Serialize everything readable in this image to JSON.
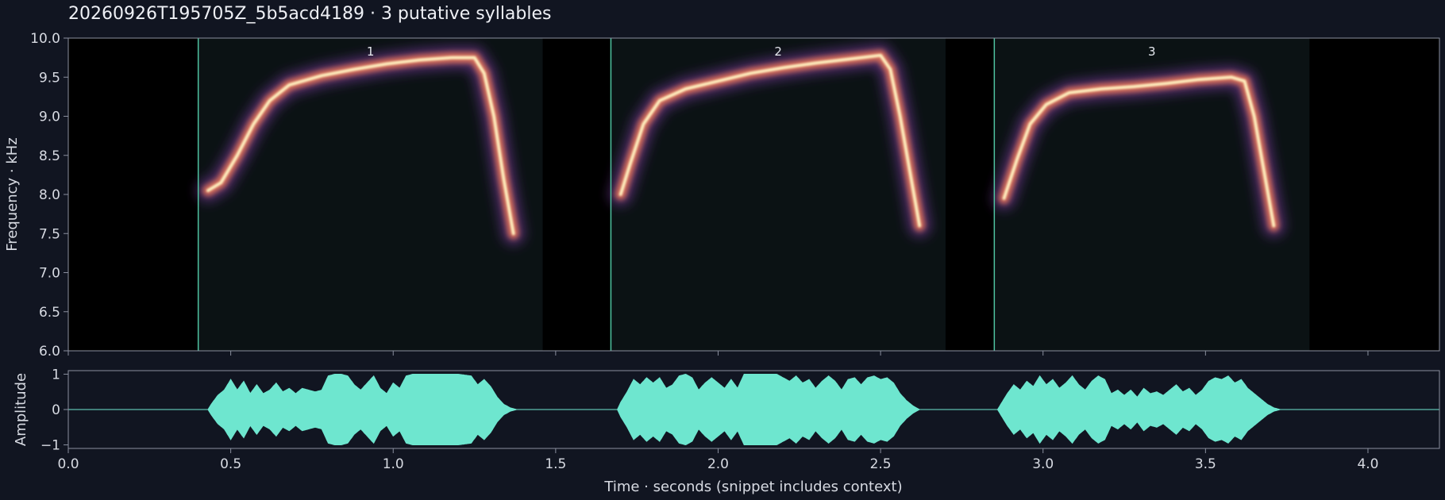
{
  "chart_data": [
    {
      "type": "heatmap",
      "title": "20260926T195705Z_5b5acd4189  ·  3 putative syllables",
      "ylabel": "Frequency · kHz",
      "xlim": [
        0.0,
        4.22
      ],
      "ylim": [
        6.0,
        10.0
      ],
      "yticks": [
        "6.0",
        "6.5",
        "7.0",
        "7.5",
        "8.0",
        "8.5",
        "9.0",
        "9.5",
        "10.0"
      ],
      "yticks_values": [
        6.0,
        6.5,
        7.0,
        7.5,
        8.0,
        8.5,
        9.0,
        9.5,
        10.0
      ],
      "xticks_values": [
        0.0,
        0.5,
        1.0,
        1.5,
        2.0,
        2.5,
        3.0,
        3.5,
        4.0
      ],
      "grid": false,
      "syllables": [
        {
          "label": "1",
          "start": 0.4,
          "end": 1.46,
          "contour": [
            [
              0.43,
              8.05
            ],
            [
              0.47,
              8.15
            ],
            [
              0.52,
              8.5
            ],
            [
              0.57,
              8.9
            ],
            [
              0.62,
              9.2
            ],
            [
              0.68,
              9.4
            ],
            [
              0.78,
              9.52
            ],
            [
              0.88,
              9.6
            ],
            [
              0.98,
              9.67
            ],
            [
              1.08,
              9.72
            ],
            [
              1.18,
              9.75
            ],
            [
              1.25,
              9.75
            ],
            [
              1.28,
              9.55
            ],
            [
              1.31,
              9.0
            ],
            [
              1.34,
              8.2
            ],
            [
              1.37,
              7.5
            ]
          ]
        },
        {
          "label": "2",
          "start": 1.67,
          "end": 2.7,
          "contour": [
            [
              1.7,
              8.0
            ],
            [
              1.73,
              8.4
            ],
            [
              1.77,
              8.9
            ],
            [
              1.82,
              9.2
            ],
            [
              1.9,
              9.35
            ],
            [
              2.0,
              9.45
            ],
            [
              2.1,
              9.55
            ],
            [
              2.2,
              9.62
            ],
            [
              2.3,
              9.68
            ],
            [
              2.4,
              9.73
            ],
            [
              2.5,
              9.78
            ],
            [
              2.53,
              9.6
            ],
            [
              2.56,
              9.0
            ],
            [
              2.59,
              8.3
            ],
            [
              2.62,
              7.6
            ]
          ]
        },
        {
          "label": "3",
          "start": 2.85,
          "end": 3.82,
          "contour": [
            [
              2.88,
              7.95
            ],
            [
              2.92,
              8.45
            ],
            [
              2.96,
              8.9
            ],
            [
              3.01,
              9.15
            ],
            [
              3.08,
              9.3
            ],
            [
              3.18,
              9.35
            ],
            [
              3.28,
              9.38
            ],
            [
              3.38,
              9.42
            ],
            [
              3.48,
              9.47
            ],
            [
              3.58,
              9.5
            ],
            [
              3.62,
              9.45
            ],
            [
              3.65,
              9.0
            ],
            [
              3.68,
              8.3
            ],
            [
              3.71,
              7.6
            ]
          ]
        }
      ]
    },
    {
      "type": "line",
      "ylabel": "Amplitude",
      "xlabel": "Time · seconds (snippet includes context)",
      "xlim": [
        0.0,
        4.22
      ],
      "ylim": [
        -1.1,
        1.1
      ],
      "yticks": [
        "−1",
        "0",
        "1"
      ],
      "yticks_values": [
        -1,
        0,
        1
      ],
      "xticks": [
        "0.0",
        "0.5",
        "1.0",
        "1.5",
        "2.0",
        "2.5",
        "3.0",
        "3.5",
        "4.0"
      ],
      "xticks_values": [
        0.0,
        0.5,
        1.0,
        1.5,
        2.0,
        2.5,
        3.0,
        3.5,
        4.0
      ],
      "series": [
        {
          "envelope": [
            [
              0.0,
              0.0
            ],
            [
              0.43,
              0.0
            ],
            [
              0.44,
              0.15
            ],
            [
              0.46,
              0.4
            ],
            [
              0.48,
              0.55
            ],
            [
              0.5,
              0.85
            ],
            [
              0.52,
              0.55
            ],
            [
              0.54,
              0.8
            ],
            [
              0.56,
              0.45
            ],
            [
              0.58,
              0.7
            ],
            [
              0.6,
              0.45
            ],
            [
              0.62,
              0.55
            ],
            [
              0.64,
              0.75
            ],
            [
              0.66,
              0.5
            ],
            [
              0.68,
              0.6
            ],
            [
              0.7,
              0.45
            ],
            [
              0.72,
              0.6
            ],
            [
              0.74,
              0.55
            ],
            [
              0.76,
              0.5
            ],
            [
              0.78,
              0.55
            ],
            [
              0.8,
              0.95
            ],
            [
              0.82,
              1.0
            ],
            [
              0.84,
              1.0
            ],
            [
              0.86,
              0.95
            ],
            [
              0.88,
              0.7
            ],
            [
              0.9,
              0.55
            ],
            [
              0.92,
              0.75
            ],
            [
              0.94,
              0.95
            ],
            [
              0.96,
              0.6
            ],
            [
              0.98,
              0.45
            ],
            [
              1.0,
              0.75
            ],
            [
              1.02,
              0.6
            ],
            [
              1.04,
              0.95
            ],
            [
              1.06,
              1.0
            ],
            [
              1.1,
              1.0
            ],
            [
              1.15,
              1.0
            ],
            [
              1.2,
              1.0
            ],
            [
              1.24,
              0.95
            ],
            [
              1.26,
              0.7
            ],
            [
              1.28,
              0.85
            ],
            [
              1.3,
              0.65
            ],
            [
              1.32,
              0.35
            ],
            [
              1.34,
              0.15
            ],
            [
              1.36,
              0.05
            ],
            [
              1.38,
              0.0
            ],
            [
              1.69,
              0.0
            ],
            [
              1.7,
              0.2
            ],
            [
              1.72,
              0.5
            ],
            [
              1.74,
              0.85
            ],
            [
              1.76,
              0.7
            ],
            [
              1.78,
              0.9
            ],
            [
              1.8,
              0.75
            ],
            [
              1.82,
              0.9
            ],
            [
              1.84,
              0.6
            ],
            [
              1.86,
              0.7
            ],
            [
              1.88,
              0.95
            ],
            [
              1.9,
              1.0
            ],
            [
              1.92,
              0.9
            ],
            [
              1.94,
              0.55
            ],
            [
              1.96,
              0.75
            ],
            [
              1.98,
              0.9
            ],
            [
              2.0,
              0.75
            ],
            [
              2.02,
              0.6
            ],
            [
              2.04,
              0.85
            ],
            [
              2.06,
              0.6
            ],
            [
              2.08,
              1.0
            ],
            [
              2.1,
              1.0
            ],
            [
              2.14,
              1.0
            ],
            [
              2.18,
              1.0
            ],
            [
              2.2,
              0.9
            ],
            [
              2.22,
              0.8
            ],
            [
              2.24,
              0.95
            ],
            [
              2.26,
              0.75
            ],
            [
              2.28,
              0.85
            ],
            [
              2.3,
              0.6
            ],
            [
              2.32,
              0.8
            ],
            [
              2.34,
              0.95
            ],
            [
              2.36,
              0.8
            ],
            [
              2.38,
              0.55
            ],
            [
              2.4,
              0.85
            ],
            [
              2.42,
              0.9
            ],
            [
              2.44,
              0.7
            ],
            [
              2.46,
              0.9
            ],
            [
              2.48,
              0.95
            ],
            [
              2.5,
              0.85
            ],
            [
              2.52,
              0.9
            ],
            [
              2.54,
              0.75
            ],
            [
              2.56,
              0.45
            ],
            [
              2.58,
              0.25
            ],
            [
              2.6,
              0.1
            ],
            [
              2.62,
              0.0
            ],
            [
              2.86,
              0.0
            ],
            [
              2.87,
              0.15
            ],
            [
              2.89,
              0.45
            ],
            [
              2.91,
              0.7
            ],
            [
              2.93,
              0.55
            ],
            [
              2.95,
              0.8
            ],
            [
              2.97,
              0.65
            ],
            [
              2.99,
              0.95
            ],
            [
              3.01,
              0.7
            ],
            [
              3.03,
              0.85
            ],
            [
              3.05,
              0.6
            ],
            [
              3.07,
              0.75
            ],
            [
              3.09,
              0.95
            ],
            [
              3.11,
              0.7
            ],
            [
              3.13,
              0.55
            ],
            [
              3.15,
              0.8
            ],
            [
              3.17,
              0.95
            ],
            [
              3.19,
              0.85
            ],
            [
              3.21,
              0.45
            ],
            [
              3.23,
              0.55
            ],
            [
              3.25,
              0.4
            ],
            [
              3.27,
              0.55
            ],
            [
              3.29,
              0.35
            ],
            [
              3.31,
              0.6
            ],
            [
              3.33,
              0.45
            ],
            [
              3.35,
              0.5
            ],
            [
              3.37,
              0.4
            ],
            [
              3.39,
              0.55
            ],
            [
              3.41,
              0.7
            ],
            [
              3.43,
              0.5
            ],
            [
              3.45,
              0.6
            ],
            [
              3.47,
              0.4
            ],
            [
              3.49,
              0.55
            ],
            [
              3.51,
              0.8
            ],
            [
              3.53,
              0.9
            ],
            [
              3.55,
              0.85
            ],
            [
              3.57,
              0.95
            ],
            [
              3.59,
              0.75
            ],
            [
              3.61,
              0.85
            ],
            [
              3.63,
              0.6
            ],
            [
              3.65,
              0.45
            ],
            [
              3.67,
              0.3
            ],
            [
              3.69,
              0.15
            ],
            [
              3.71,
              0.05
            ],
            [
              3.73,
              0.0
            ],
            [
              4.22,
              0.0
            ]
          ]
        }
      ]
    }
  ],
  "colors": {
    "background": "#111521",
    "spectro_bg": "#000000",
    "region_bg": "#0b1214",
    "boundary": "#4fc3a1",
    "waveform": "#6ee6cf",
    "axis": "#8a8f9e",
    "hot": "#fff1c0",
    "mid": "#f07a57",
    "low": "#7a3aa0"
  }
}
